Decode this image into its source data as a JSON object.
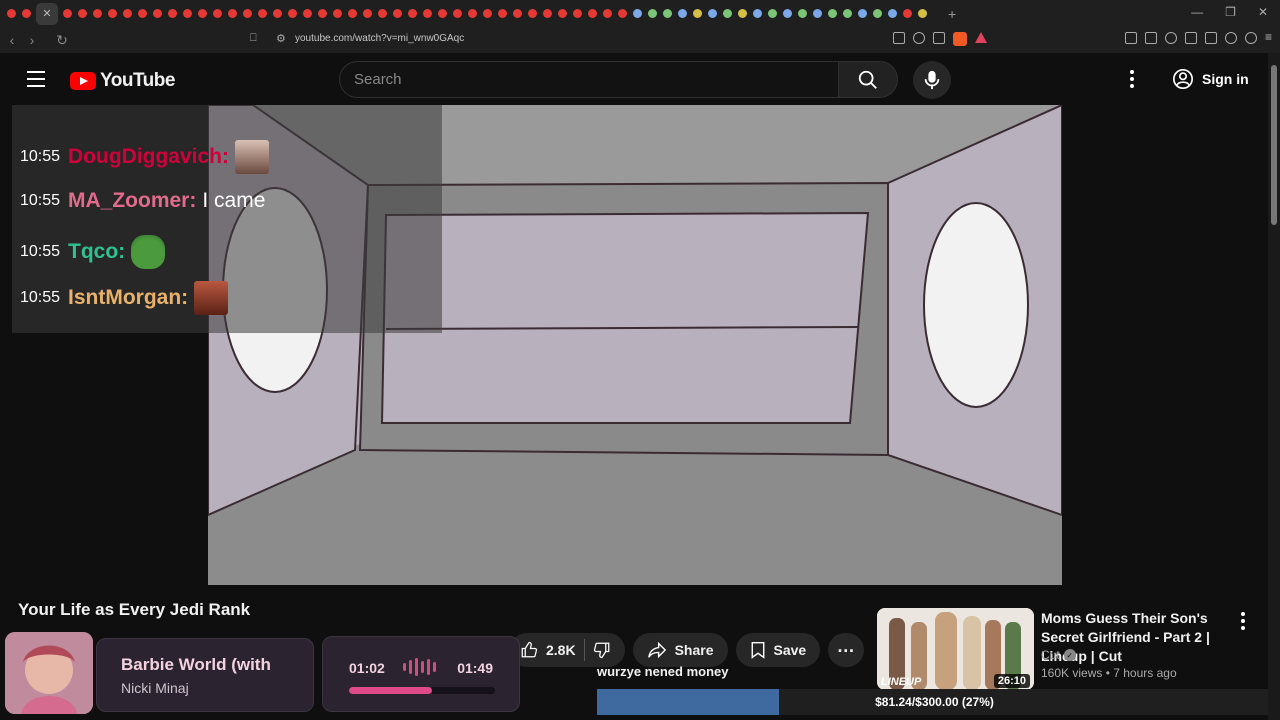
{
  "browser": {
    "url": "youtube.com/watch?v=mi_wnw0GAqc"
  },
  "header": {
    "logo_text": "YouTube",
    "search_placeholder": "Search",
    "sign_in": "Sign in"
  },
  "chat": [
    {
      "time": "10:55",
      "user": "DougDiggavich",
      "sep": ":",
      "message": "",
      "color": "#d0003a"
    },
    {
      "time": "10:55",
      "user": "MA_Zoomer",
      "sep": ":",
      "message": "I came",
      "color": "#e06b8a"
    },
    {
      "time": "10:55",
      "user": "Tqco",
      "sep": ":",
      "message": "",
      "color": "#2fc290"
    },
    {
      "time": "10:55",
      "user": "IsntMorgan",
      "sep": ":",
      "message": "",
      "color": "#e8b26a"
    }
  ],
  "video": {
    "title": "Your Life as Every Jedi Rank",
    "likes": "2.8K",
    "share_label": "Share",
    "save_label": "Save"
  },
  "recommendation": {
    "title": "Moms Guess Their Son's Secret Girlfriend - Part 2 | Lineup | Cut",
    "channel": "Cut",
    "meta": "160K views • 7 hours ago",
    "duration": "26:10",
    "thumb_brand": "LINEUP"
  },
  "now_playing": {
    "song": "Barbie World (with",
    "artist": "Nicki Minaj",
    "current": "01:02",
    "duration": "01:49",
    "progress_fraction": 0.57
  },
  "goal": {
    "text": "wurzye nened money",
    "label": "$81.24/$300.00 (27%)",
    "fraction": 0.27
  }
}
